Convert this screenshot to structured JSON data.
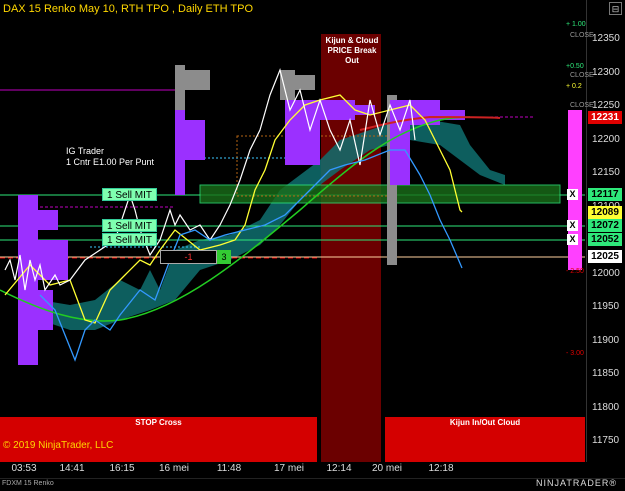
{
  "title": "DAX 15 Renko May 10, RTH TPO , Daily ETH TPO",
  "window_button": "⊟",
  "price_axis": [
    "12350",
    "12300",
    "12250",
    "12200",
    "12150",
    "12100",
    "12050",
    "12000",
    "11950",
    "11900",
    "11850",
    "11800",
    "11750"
  ],
  "time_axis": [
    "03:53",
    "14:41",
    "16:15",
    "16 mei",
    "11:48",
    "17 mei",
    "12:14",
    "20 mei",
    "12:18"
  ],
  "price_tags": {
    "current": "12231",
    "level_1": "12117",
    "level_2": "12089",
    "level_3": "12072",
    "level_4": "12052",
    "level_5": "12025"
  },
  "small_labels": {
    "l1": "+ 1.00",
    "l2": "CLOSE",
    "l3": "+0.50",
    "l4": "CLOSE",
    "l5": "+ 0.2",
    "l6": "CLOSE",
    "l7": "- 2.50",
    "l8": "- 3.00"
  },
  "orders": {
    "sell1": "1 Sell MIT",
    "sell2": "1 Sell MIT",
    "sell3": "1 Sell MIT"
  },
  "account": {
    "line1": "IG Trader",
    "line2": "1 Cntr E1.00 Per Punt"
  },
  "position": {
    "pnl": "-1",
    "qty": "3"
  },
  "xbox": "X",
  "annotations": {
    "kijun_break": "Kijun & Cloud PRICE Break Out",
    "stop_cross": "STOP Cross",
    "kijun_inout": "Kijun In/Out Cloud"
  },
  "copyright": "© 2019 NinjaTrader, LLC",
  "instrument": "FDXM 15 Renko",
  "brand": "NINJATRADER®",
  "colors": {
    "title": "#ffd700",
    "cloud": "#0f6e6e",
    "tpo_purple": "#9b30ff",
    "tpo_gray": "#8c8c8c",
    "kijun_red": "#b40000",
    "annotation_red": "#d40000",
    "order_green": "#7fffaf"
  }
}
